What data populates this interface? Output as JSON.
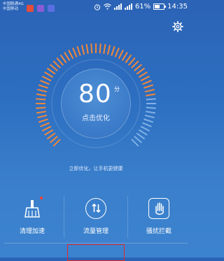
{
  "status": {
    "carrier1": "中国联通4G",
    "carrier2": "中国移动",
    "battery_percent": "61%",
    "battery_level": 0.61,
    "time": "14:35"
  },
  "main": {
    "score": "80",
    "score_unit": "分",
    "optimize_label": "点击优化",
    "tip": "立即优化，让手机更健康",
    "dial_fill_fraction": 0.8
  },
  "tools": [
    {
      "label": "清理加速",
      "icon": "broom-icon",
      "has_badge": true
    },
    {
      "label": "流量管理",
      "icon": "data-arrows-icon",
      "has_badge": false
    },
    {
      "label": "骚扰拦截",
      "icon": "hand-block-icon",
      "has_badge": false
    }
  ],
  "colors": {
    "accent_orange": "#f0873a",
    "inactive_tick": "#7fb0e6",
    "badge_red": "#ff3b30",
    "highlight_red": "#e02a2a"
  }
}
